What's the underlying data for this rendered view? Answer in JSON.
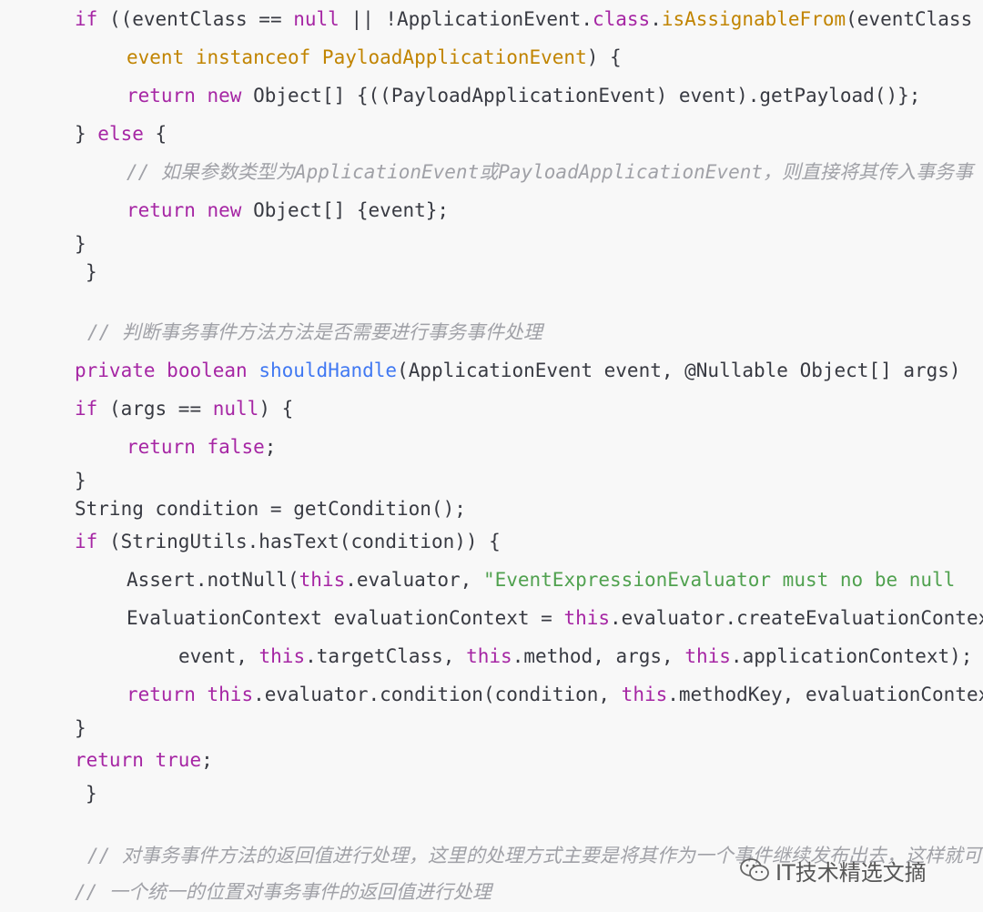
{
  "code": {
    "lines": [
      {
        "tokens": [
          {
            "t": "if",
            "c": "kw"
          },
          {
            "t": " ((eventClass == ",
            "c": "plain"
          },
          {
            "t": "null",
            "c": "kw"
          },
          {
            "t": " || !ApplicationEvent.",
            "c": "plain"
          },
          {
            "t": "class",
            "c": "kw"
          },
          {
            "t": ".",
            "c": "plain"
          },
          {
            "t": "isAssignableFrom",
            "c": "type"
          },
          {
            "t": "(eventClass",
            "c": "plain"
          }
        ]
      },
      {
        "tokens": [
          {
            "t": "event instanceof PayloadApplicationEvent",
            "c": "type"
          },
          {
            "t": ") {",
            "c": "plain"
          }
        ]
      },
      {
        "tokens": [
          {
            "t": "return",
            "c": "kw"
          },
          {
            "t": " ",
            "c": "plain"
          },
          {
            "t": "new",
            "c": "kw"
          },
          {
            "t": " Object[] {((PayloadApplicationEvent) event).getPayload()};",
            "c": "plain"
          }
        ]
      },
      {
        "tokens": [
          {
            "t": "} ",
            "c": "plain"
          },
          {
            "t": "else",
            "c": "kw"
          },
          {
            "t": " {",
            "c": "plain"
          }
        ]
      },
      {
        "tokens": [
          {
            "t": "// 如果参数类型为ApplicationEvent或PayloadApplicationEvent，则直接将其传入事务事",
            "c": "cm"
          }
        ]
      },
      {
        "tokens": [
          {
            "t": "return",
            "c": "kw"
          },
          {
            "t": " ",
            "c": "plain"
          },
          {
            "t": "new",
            "c": "kw"
          },
          {
            "t": " Object[] {event};",
            "c": "plain"
          }
        ]
      },
      {
        "tokens": [
          {
            "t": "}",
            "c": "plain"
          }
        ]
      },
      {
        "tokens": [
          {
            "t": "}",
            "c": "plain"
          }
        ]
      },
      {
        "tokens": [
          {
            "t": "// 判断事务事件方法方法是否需要进行事务事件处理",
            "c": "cm"
          }
        ]
      },
      {
        "tokens": [
          {
            "t": "private",
            "c": "kw"
          },
          {
            "t": " ",
            "c": "plain"
          },
          {
            "t": "boolean",
            "c": "kw"
          },
          {
            "t": " ",
            "c": "plain"
          },
          {
            "t": "shouldHandle",
            "c": "fn"
          },
          {
            "t": "(ApplicationEvent event, @Nullable Object[] args)",
            "c": "plain"
          }
        ]
      },
      {
        "tokens": [
          {
            "t": "if",
            "c": "kw"
          },
          {
            "t": " (args == ",
            "c": "plain"
          },
          {
            "t": "null",
            "c": "kw"
          },
          {
            "t": ") {",
            "c": "plain"
          }
        ]
      },
      {
        "tokens": [
          {
            "t": "return",
            "c": "kw"
          },
          {
            "t": " ",
            "c": "plain"
          },
          {
            "t": "false",
            "c": "kw"
          },
          {
            "t": ";",
            "c": "plain"
          }
        ]
      },
      {
        "tokens": [
          {
            "t": "}",
            "c": "plain"
          }
        ]
      },
      {
        "tokens": [
          {
            "t": "String condition = getCondition();",
            "c": "plain"
          }
        ]
      },
      {
        "tokens": [
          {
            "t": "if",
            "c": "kw"
          },
          {
            "t": " (StringUtils.hasText(condition)) {",
            "c": "plain"
          }
        ]
      },
      {
        "tokens": [
          {
            "t": "Assert.notNull(",
            "c": "plain"
          },
          {
            "t": "this",
            "c": "kw"
          },
          {
            "t": ".evaluator, ",
            "c": "plain"
          },
          {
            "t": "\"EventExpressionEvaluator must no be null",
            "c": "str"
          }
        ]
      },
      {
        "tokens": [
          {
            "t": "EvaluationContext evaluationContext = ",
            "c": "plain"
          },
          {
            "t": "this",
            "c": "kw"
          },
          {
            "t": ".evaluator.createEvaluationContext",
            "c": "plain"
          }
        ]
      },
      {
        "tokens": [
          {
            "t": "event, ",
            "c": "plain"
          },
          {
            "t": "this",
            "c": "kw"
          },
          {
            "t": ".targetClass, ",
            "c": "plain"
          },
          {
            "t": "this",
            "c": "kw"
          },
          {
            "t": ".method, args, ",
            "c": "plain"
          },
          {
            "t": "this",
            "c": "kw"
          },
          {
            "t": ".applicationContext);",
            "c": "plain"
          }
        ]
      },
      {
        "tokens": [
          {
            "t": "return",
            "c": "kw"
          },
          {
            "t": " ",
            "c": "plain"
          },
          {
            "t": "this",
            "c": "kw"
          },
          {
            "t": ".evaluator.condition(condition, ",
            "c": "plain"
          },
          {
            "t": "this",
            "c": "kw"
          },
          {
            "t": ".methodKey, evaluationContext",
            "c": "plain"
          }
        ]
      },
      {
        "tokens": [
          {
            "t": "}",
            "c": "plain"
          }
        ]
      },
      {
        "tokens": [
          {
            "t": "return",
            "c": "kw"
          },
          {
            "t": " ",
            "c": "plain"
          },
          {
            "t": "true",
            "c": "kw"
          },
          {
            "t": ";",
            "c": "plain"
          }
        ]
      },
      {
        "tokens": [
          {
            "t": "}",
            "c": "plain"
          }
        ]
      },
      {
        "tokens": [
          {
            "t": "// 对事务事件方法的返回值进行处理，这里的处理方式主要是将其作为一个事件继续发布出去，这样就可以",
            "c": "cm"
          }
        ]
      },
      {
        "tokens": [
          {
            "t": "// 一个统一的位置对事务事件的返回值进行处理",
            "c": "cm"
          }
        ]
      }
    ]
  },
  "watermark": {
    "text": "IT技术精选文摘",
    "icon": "wechat-icon"
  },
  "colors": {
    "background": "#f8f8f8",
    "keyword": "#a626a4",
    "function": "#4078f2",
    "type": "#c18401",
    "string": "#50a14f",
    "comment": "#a0a1a7",
    "plain": "#383a42"
  }
}
